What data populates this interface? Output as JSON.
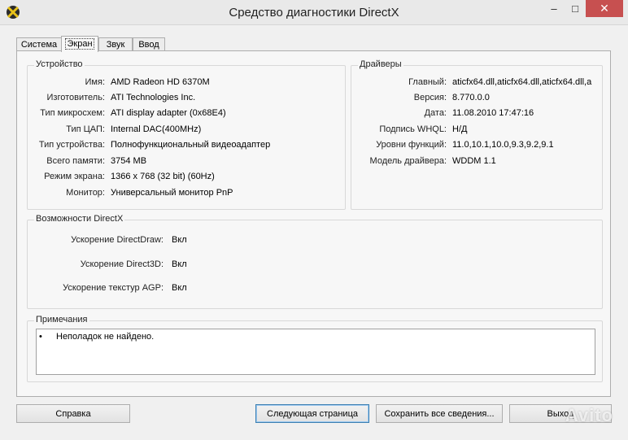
{
  "window": {
    "title": "Средство диагностики DirectX",
    "minimize": "–",
    "maximize": "□",
    "close": "✕"
  },
  "tabs": [
    "Система",
    "Экран",
    "Звук",
    "Ввод"
  ],
  "device": {
    "title": "Устройство",
    "rows": [
      {
        "label": "Имя:",
        "value": "AMD Radeon HD 6370M"
      },
      {
        "label": "Изготовитель:",
        "value": "ATI Technologies Inc."
      },
      {
        "label": "Тип микросхем:",
        "value": "ATI display adapter (0x68E4)"
      },
      {
        "label": "Тип ЦАП:",
        "value": "Internal DAC(400MHz)"
      },
      {
        "label": "Тип устройства:",
        "value": "Полнофункциональный видеоадаптер"
      },
      {
        "label": "Всего памяти:",
        "value": "3754 MB"
      },
      {
        "label": "Режим экрана:",
        "value": "1366 x 768 (32 bit) (60Hz)"
      },
      {
        "label": "Монитор:",
        "value": "Универсальный монитор PnP"
      }
    ]
  },
  "drivers": {
    "title": "Драйверы",
    "rows": [
      {
        "label": "Главный:",
        "value": "aticfx64.dll,aticfx64.dll,aticfx64.dll,a"
      },
      {
        "label": "Версия:",
        "value": "8.770.0.0"
      },
      {
        "label": "Дата:",
        "value": "11.08.2010 17:47:16"
      },
      {
        "label": "Подпись WHQL:",
        "value": "Н/Д"
      },
      {
        "label": "Уровни функций:",
        "value": "11.0,10.1,10.0,9.3,9.2,9.1"
      },
      {
        "label": "Модель драйвера:",
        "value": "WDDM 1.1"
      }
    ]
  },
  "directx": {
    "title": "Возможности DirectX",
    "rows": [
      {
        "label": "Ускорение DirectDraw:",
        "value": "Вкл"
      },
      {
        "label": "Ускорение Direct3D:",
        "value": "Вкл"
      },
      {
        "label": "Ускорение текстур AGP:",
        "value": "Вкл"
      }
    ]
  },
  "notes": {
    "title": "Примечания",
    "bullet": "•",
    "text": "Неполадок не найдено."
  },
  "buttons": {
    "help": "Справка",
    "next": "Следующая страница",
    "save": "Сохранить все сведения...",
    "exit": "Выход"
  },
  "watermark": "Avito"
}
